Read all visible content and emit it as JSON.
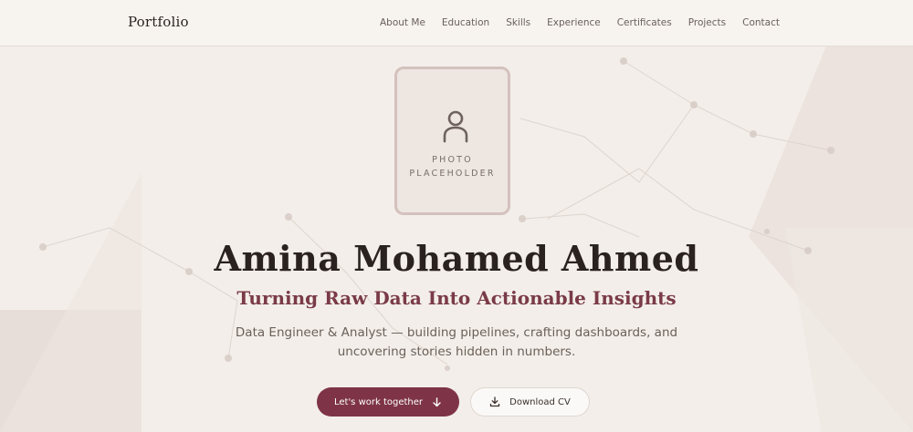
{
  "nav": {
    "brand": "Portfolio",
    "links": [
      {
        "label": "About Me"
      },
      {
        "label": "Education"
      },
      {
        "label": "Skills"
      },
      {
        "label": "Experience"
      },
      {
        "label": "Certificates"
      },
      {
        "label": "Projects"
      },
      {
        "label": "Contact"
      }
    ]
  },
  "hero": {
    "photo_placeholder_line1": "PHOTO",
    "photo_placeholder_line2": "PLACEHOLDER",
    "name": "Amina Mohamed Ahmed",
    "tagline": "Turning Raw Data Into Actionable Insights",
    "description": "Data Engineer & Analyst — building pipelines, crafting dashboards, and uncovering stories hidden in numbers.",
    "primary_button": {
      "label": "Let's work together",
      "icon": "arrow-down-icon"
    },
    "secondary_button": {
      "label": "Download CV",
      "icon": "download-icon"
    }
  },
  "colors": {
    "accent": "#7e3446",
    "tagline": "#7a3a48",
    "background": "#f3eee9",
    "text_dark": "#2a221e",
    "text_muted": "#6b605a"
  }
}
